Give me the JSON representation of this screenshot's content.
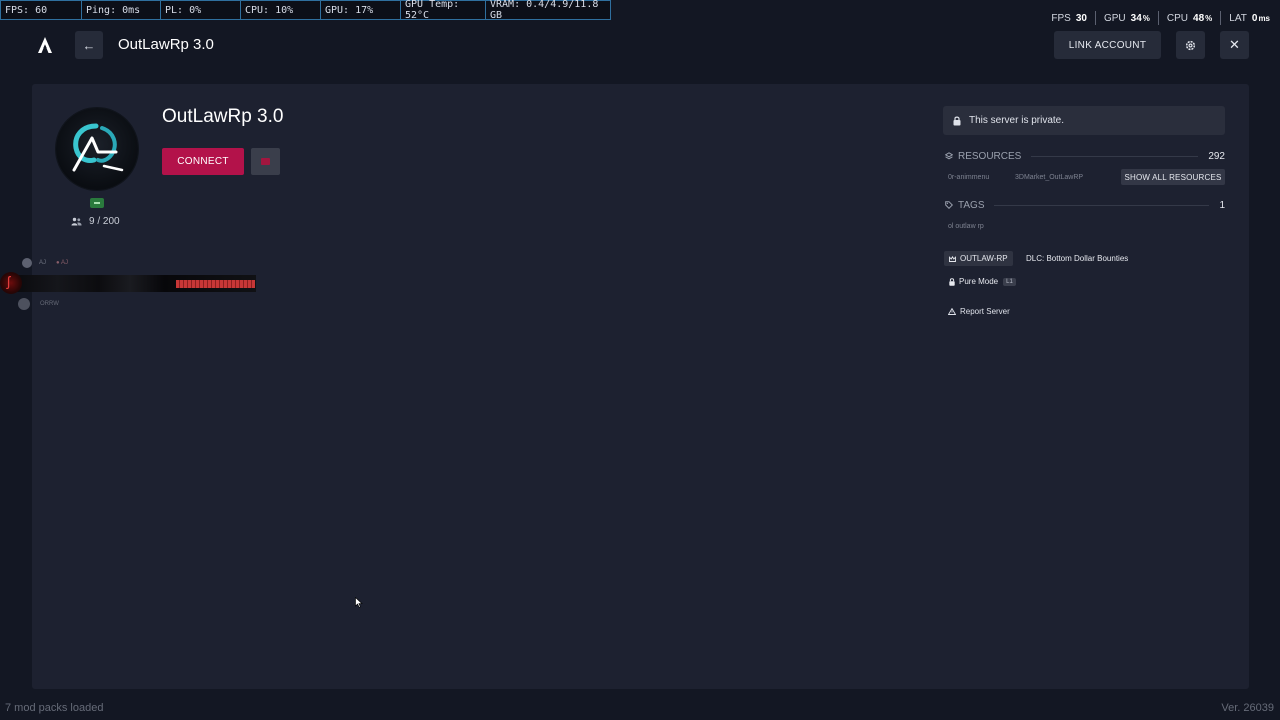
{
  "perf_overlay": [
    {
      "label": "FPS: 60"
    },
    {
      "label": "Ping: 0ms"
    },
    {
      "label": "PL: 0%"
    },
    {
      "label": "CPU: 10%"
    },
    {
      "label": "GPU: 17%"
    },
    {
      "label": "GPU Temp: 52°C"
    },
    {
      "label": "VRAM: 0.4/4.9/11.8 GB"
    }
  ],
  "perf_right": {
    "fps": {
      "label": "FPS",
      "value": "30"
    },
    "gpu": {
      "label": "GPU",
      "value": "34",
      "unit": "%"
    },
    "cpu": {
      "label": "CPU",
      "value": "48",
      "unit": "%"
    },
    "lat": {
      "label": "LAT",
      "value": "0",
      "unit": "ms"
    }
  },
  "nav": {
    "back_glyph": "←",
    "title": "OutLawRp 3.0",
    "link_account": "LINK ACCOUNT",
    "close_glyph": "✕"
  },
  "server": {
    "name": "OutLawRp 3.0",
    "connect_label": "CONNECT",
    "players": "9 / 200"
  },
  "glitch": {
    "tag1": "AJ",
    "tag2": "● AJ",
    "tag3": "ORRW"
  },
  "sidebar": {
    "private_text": "This server is private.",
    "resources_label": "RESOURCES",
    "resources_count": "292",
    "resources": [
      "0r-animmenu",
      "3DMarket_OutLawRP"
    ],
    "show_all_label": "SHOW ALL RESOURCES",
    "tags_label": "TAGS",
    "tags_count": "1",
    "tags": [
      "ol outlaw rp"
    ],
    "badge_outlaw": "OUTLAW-RP",
    "badge_dlc": "DLC: Bottom Dollar Bounties",
    "badge_pure": "Pure Mode",
    "pure_level": "L1",
    "report_label": "Report Server"
  },
  "footer": {
    "left": "7 mod packs loaded",
    "right": "Ver. 26039"
  },
  "colors": {
    "background": "#131723",
    "panel": "#1d2130",
    "accent": "#b3124a",
    "status_online": "#2a7a3d"
  }
}
